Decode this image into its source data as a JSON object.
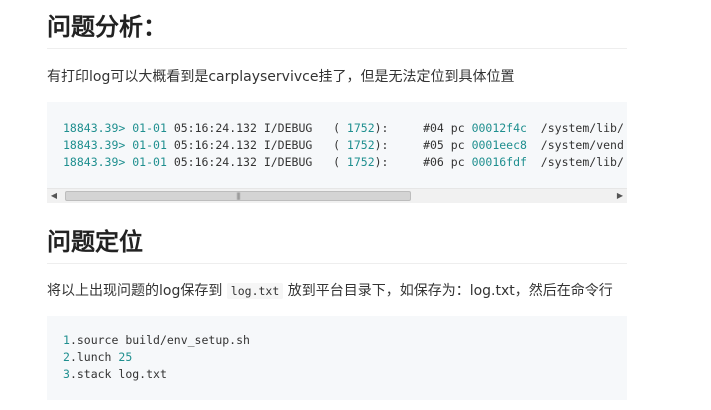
{
  "section1": {
    "heading": "问题分析：",
    "paragraph": "有打印log可以大概看到是carplayservivce挂了，但是无法定位到具体位置",
    "log_lines": [
      {
        "prefix": "18843.39> ",
        "date": "01-01",
        "time": "05:16:24.132",
        "tag": " I/DEBUG   ( ",
        "pid": "1752",
        "mid": "):     #04 pc ",
        "addr": "00012f4c",
        "path": "  /system/lib/"
      },
      {
        "prefix": "18843.39> ",
        "date": "01-01",
        "time": "05:16:24.132",
        "tag": " I/DEBUG   ( ",
        "pid": "1752",
        "mid": "):     #05 pc ",
        "addr": "0001eec8",
        "path": "  /system/vend"
      },
      {
        "prefix": "18843.39> ",
        "date": "01-01",
        "time": "05:16:24.132",
        "tag": " I/DEBUG   ( ",
        "pid": "1752",
        "mid": "):     #06 pc ",
        "addr": "00016fdf",
        "path": "  /system/lib/"
      }
    ]
  },
  "section2": {
    "heading": "问题定位",
    "paragraph_before": "将以上出现问题的log保存到",
    "inline_code": "log.txt",
    "paragraph_after": "放到平台目录下，如保存为：log.txt，然后在命令行",
    "commands": [
      {
        "num": "1",
        "text": ".source build/env_setup.sh",
        "arg": ""
      },
      {
        "num": "2",
        "text": ".lunch ",
        "arg": "25"
      },
      {
        "num": "3",
        "text": ".stack log.txt",
        "arg": ""
      }
    ]
  },
  "icons": {
    "left_arrow": "scroll-left-arrow-icon",
    "right_arrow": "scroll-right-arrow-icon",
    "grip": "scroll-grip-icon"
  },
  "colors": {
    "code_number": "#1f8f8f",
    "code_bg": "#f6f8fa"
  }
}
